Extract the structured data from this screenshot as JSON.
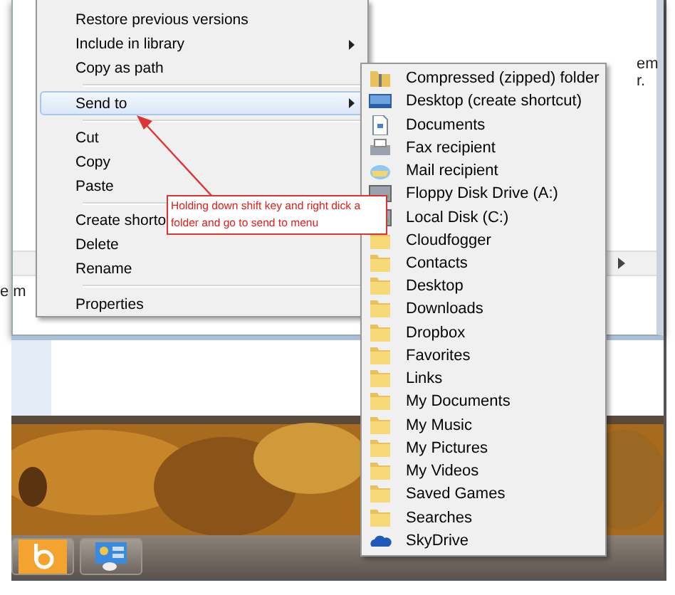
{
  "background_window": {
    "fragments": [
      {
        "text": "em"
      },
      {
        "text": "r."
      },
      {
        "text": "e m"
      }
    ]
  },
  "context_menu": {
    "groups": [
      [
        {
          "label": "Restore previous versions",
          "selected": false
        },
        {
          "label": "Include in library",
          "submenu": true,
          "selected": false
        },
        {
          "label": "Copy as path",
          "selected": false
        }
      ],
      [
        {
          "label": "Send to",
          "submenu": true,
          "selected": true
        }
      ],
      [
        {
          "label": "Cut",
          "selected": false
        },
        {
          "label": "Copy",
          "selected": false
        },
        {
          "label": "Paste",
          "selected": false
        }
      ],
      [
        {
          "label": "Create shorto",
          "selected": false
        },
        {
          "label": "Delete",
          "selected": false
        },
        {
          "label": "Rename",
          "selected": false
        }
      ],
      [
        {
          "label": "Properties",
          "selected": false
        }
      ]
    ]
  },
  "send_to_menu": {
    "items": [
      {
        "label": "Compressed (zipped) folder",
        "kind": "zip"
      },
      {
        "label": "Desktop (create shortcut)",
        "kind": "desktop"
      },
      {
        "label": "Documents",
        "kind": "document"
      },
      {
        "label": "Fax recipient",
        "kind": "fax"
      },
      {
        "label": "Mail recipient",
        "kind": "mail"
      },
      {
        "label": "Floppy Disk Drive (A:)",
        "kind": "drive"
      },
      {
        "label": "Local Disk (C:)",
        "kind": "drive"
      },
      {
        "label": "Cloudfogger",
        "kind": "folder"
      },
      {
        "label": "Contacts",
        "kind": "folder"
      },
      {
        "label": "Desktop",
        "kind": "folder"
      },
      {
        "label": "Downloads",
        "kind": "folder"
      },
      {
        "label": "Dropbox",
        "kind": "folder"
      },
      {
        "label": "Favorites",
        "kind": "folder"
      },
      {
        "label": "Links",
        "kind": "folder"
      },
      {
        "label": "My Documents",
        "kind": "folder"
      },
      {
        "label": "My Music",
        "kind": "folder"
      },
      {
        "label": "My Pictures",
        "kind": "folder"
      },
      {
        "label": "My Videos",
        "kind": "folder"
      },
      {
        "label": "Saved Games",
        "kind": "folder"
      },
      {
        "label": "Searches",
        "kind": "folder"
      },
      {
        "label": "SkyDrive",
        "kind": "cloud"
      }
    ]
  },
  "callout": {
    "lines": [
      "Holding down shift key and right dick a",
      "folder and go to send to menu"
    ]
  },
  "taskbar": {
    "buttons": [
      {
        "kind": "search-app"
      },
      {
        "kind": "control-panel"
      }
    ]
  }
}
